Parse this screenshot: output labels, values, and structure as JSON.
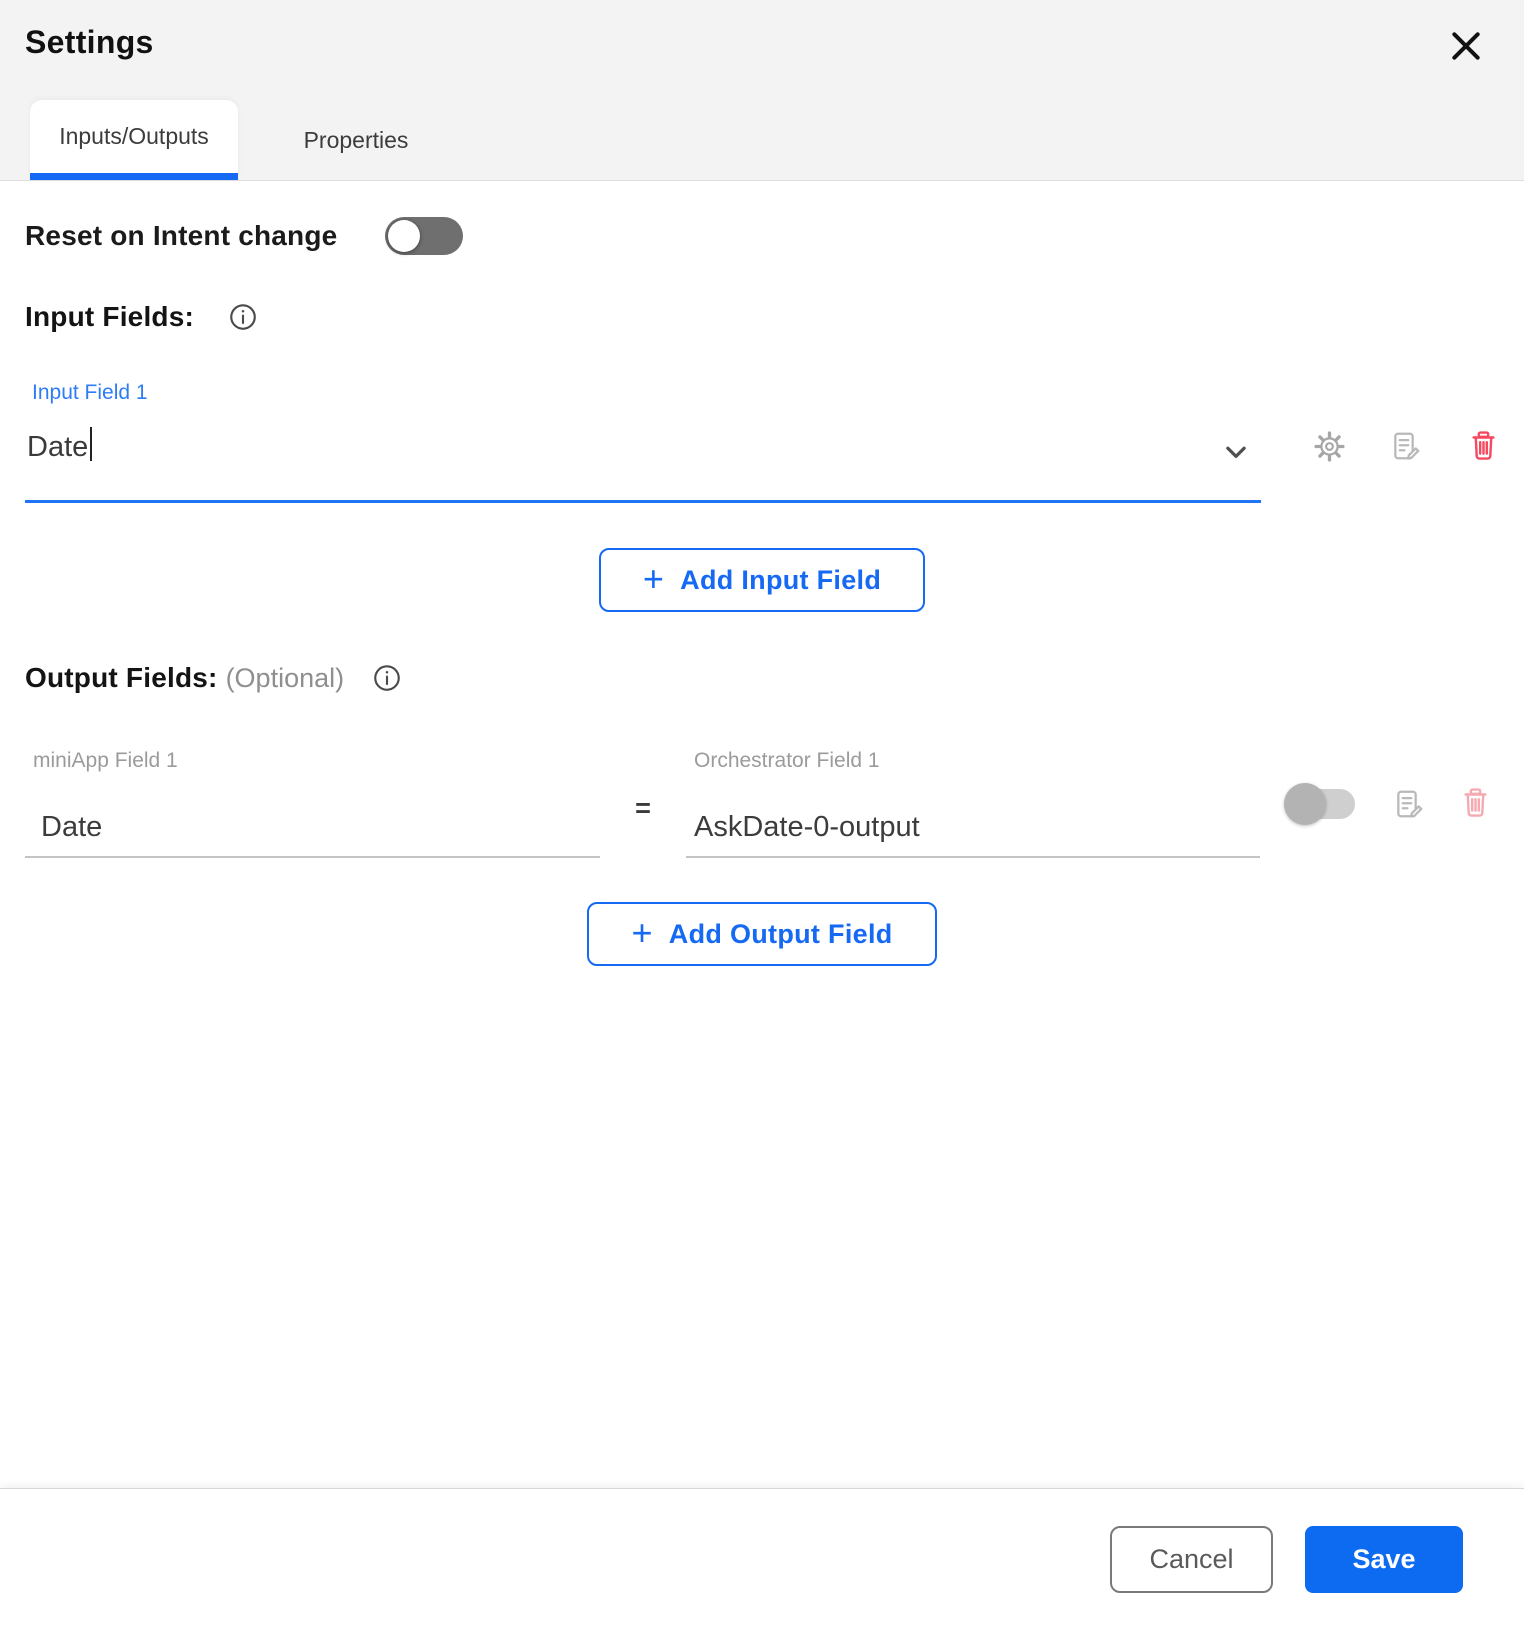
{
  "modal": {
    "title": "Settings"
  },
  "tabs": {
    "inputs_outputs": "Inputs/Outputs",
    "properties": "Properties"
  },
  "reset": {
    "label": "Reset on Intent change",
    "state": "off"
  },
  "inputs": {
    "heading": "Input Fields:",
    "field_label": "Input Field 1",
    "field_value": "Date",
    "plus": "+",
    "add_label": "Add Input Field"
  },
  "outputs": {
    "heading": "Output Fields:",
    "optional": "(Optional)",
    "miniapp_label": "miniApp Field 1",
    "miniapp_value": "Date",
    "equals": "=",
    "orchestrator_label": "Orchestrator Field 1",
    "orchestrator_value": "AskDate-0-output",
    "toggle_state": "off",
    "plus": "+",
    "add_label": "Add Output Field"
  },
  "footer": {
    "cancel": "Cancel",
    "save": "Save"
  },
  "colors": {
    "accent": "#1569f3",
    "field_label_blue": "#2e7cf6",
    "danger": "#f6495f",
    "danger_muted": "#f5a9b1",
    "header_bg": "#f3f3f4"
  }
}
